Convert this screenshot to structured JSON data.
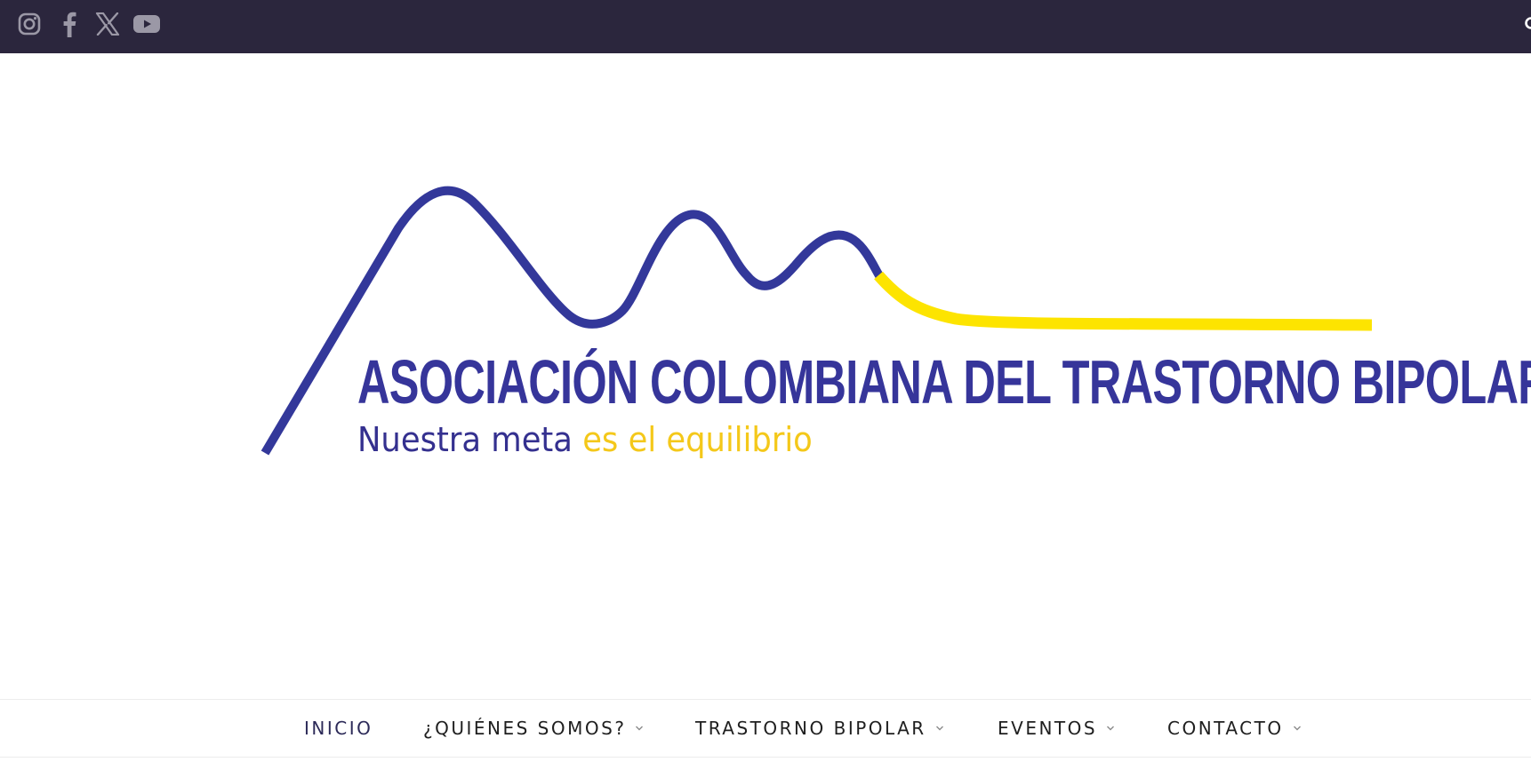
{
  "topbar": {
    "background": "#2b263d",
    "icon_color": "#9b98a6",
    "social": [
      {
        "name": "instagram",
        "icon": "instagram-icon"
      },
      {
        "name": "facebook",
        "icon": "facebook-icon"
      },
      {
        "name": "x",
        "icon": "x-twitter-icon"
      },
      {
        "name": "youtube",
        "icon": "youtube-icon"
      }
    ],
    "search_icon": "search-icon"
  },
  "logo": {
    "title": "ASOCIACIÓN COLOMBIANA DEL TRASTORNO BIPOLAR",
    "tagline_part1": "Nuestra meta",
    "tagline_part2": "es el equilibrio",
    "colors": {
      "blue": "#36359a",
      "yellow": "#fde400",
      "tagline_yellow": "#f4c81a"
    }
  },
  "nav": {
    "items": [
      {
        "label": "INICIO",
        "has_dropdown": false,
        "active": true
      },
      {
        "label": "¿QUIÉNES SOMOS?",
        "has_dropdown": true
      },
      {
        "label": "TRASTORNO BIPOLAR",
        "has_dropdown": true
      },
      {
        "label": "EVENTOS",
        "has_dropdown": true
      },
      {
        "label": "CONTACTO",
        "has_dropdown": true
      }
    ]
  }
}
